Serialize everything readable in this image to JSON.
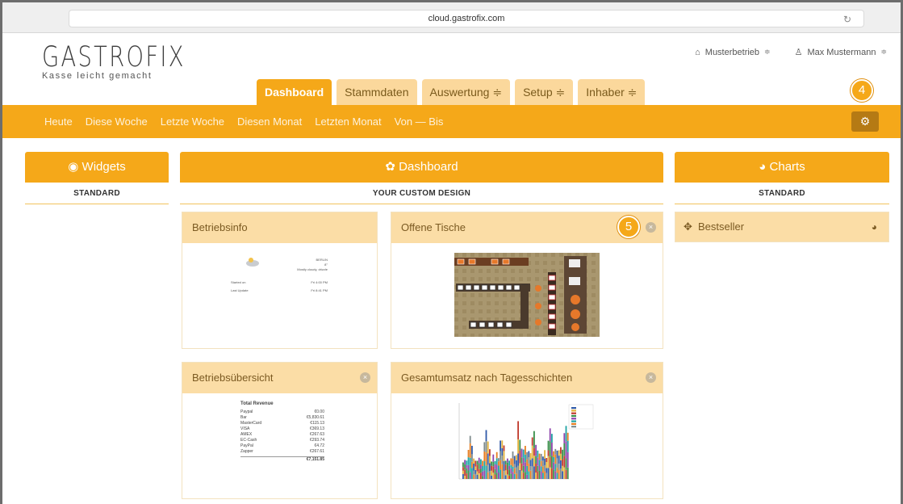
{
  "browser": {
    "url": "cloud.gastrofix.com"
  },
  "logo": {
    "name": "GASTROFIX",
    "tagline": "Kasse leicht gemacht"
  },
  "userbar": {
    "business": "Musterbetrieb",
    "user": "Max Mustermann"
  },
  "tabs": [
    {
      "label": "Dashboard"
    },
    {
      "label": "Stammdaten"
    },
    {
      "label": "Auswertung ≑"
    },
    {
      "label": "Setup ≑"
    },
    {
      "label": "Inhaber ≑"
    }
  ],
  "subnav": [
    "Heute",
    "Diese Woche",
    "Letzte Woche",
    "Diesen Monat",
    "Letzten Monat",
    "Von — Bis"
  ],
  "badges": {
    "wrench": "4",
    "close": "5"
  },
  "columns": {
    "widgets": {
      "title": "Widgets",
      "sub": "STANDARD"
    },
    "dashboard": {
      "title": "Dashboard",
      "sub": "YOUR CUSTOM DESIGN"
    },
    "charts": {
      "title": "Charts",
      "sub": "STANDARD"
    }
  },
  "panels": {
    "betriebsinfo": {
      "title": "Betriebsinfo",
      "city": "BERLIN",
      "temp": "8°",
      "weather": "Mostly cloudy, drizzle",
      "started_label": "Started on",
      "started_value": "Fri 4:00 PM",
      "last_label": "Last Update",
      "last_value": "Fri 8:41 PM"
    },
    "offene_tische": {
      "title": "Offene Tische"
    },
    "betriebsuebersicht": {
      "title": "Betriebsübersicht",
      "table_title": "Total Revenue",
      "rows": [
        {
          "k": "Paypal",
          "v": "€0.00"
        },
        {
          "k": "Bar",
          "v": "€5,830.61"
        },
        {
          "k": "MasterCard",
          "v": "€115.13"
        },
        {
          "k": "VISA",
          "v": "€369.13"
        },
        {
          "k": "AMEX",
          "v": "€267.63"
        },
        {
          "k": "EC-Cash",
          "v": "€293.74"
        },
        {
          "k": "PayPal",
          "v": "€4.72"
        },
        {
          "k": "Zapper",
          "v": "€267.61"
        }
      ],
      "total": "€7,151.85"
    },
    "gesamtumsatz": {
      "title": "Gesamtumsatz nach Tagesschichten"
    },
    "bestseller": {
      "title": "Bestseller"
    }
  },
  "colors": {
    "accent": "#f5a819",
    "panel_head": "#fbdda6",
    "tab_inactive": "#fbd89c"
  }
}
